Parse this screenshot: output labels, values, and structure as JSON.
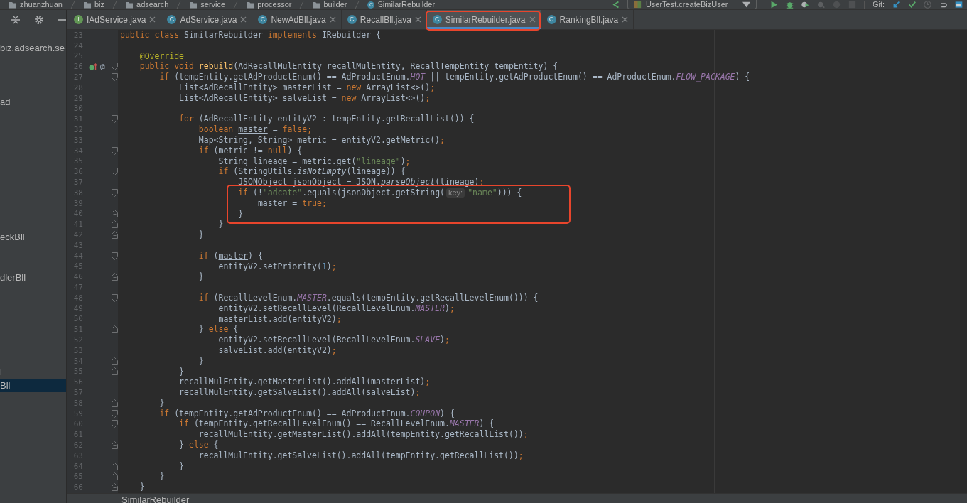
{
  "navigation_bar": {
    "path": [
      {
        "label": "zhuanzhuan",
        "kind": "folder"
      },
      {
        "label": "biz",
        "kind": "folder"
      },
      {
        "label": "adsearch",
        "kind": "folder"
      },
      {
        "label": "service",
        "kind": "folder"
      },
      {
        "label": "processor",
        "kind": "folder"
      },
      {
        "label": "builder",
        "kind": "folder"
      },
      {
        "label": "SimilarRebuilder",
        "kind": "class",
        "icon_letter": "C"
      }
    ],
    "run_configuration": "UserTest.createBizUser",
    "vcs_label": "Git:"
  },
  "project_panel": {
    "items": [
      {
        "label": "biz.adsearch.se",
        "selected": false
      },
      {
        "label": "ad",
        "selected": false
      },
      {
        "label": "eckBll",
        "selected": false
      },
      {
        "label": "dlerBll",
        "selected": false
      },
      {
        "label": "l",
        "selected": false
      },
      {
        "label": "Bll",
        "selected": true
      }
    ]
  },
  "editor_tabs": [
    {
      "label": "IAdService.java",
      "icon_letter": "I",
      "color": "#629755",
      "selected": false,
      "highlighted": false
    },
    {
      "label": "AdService.java",
      "icon_letter": "C",
      "color": "#3e86a0",
      "selected": false,
      "highlighted": false
    },
    {
      "label": "NewAdBll.java",
      "icon_letter": "C",
      "color": "#3e86a0",
      "selected": false,
      "highlighted": false
    },
    {
      "label": "RecallBll.java",
      "icon_letter": "C",
      "color": "#3e86a0",
      "selected": false,
      "highlighted": false
    },
    {
      "label": "SimilarRebuilder.java",
      "icon_letter": "C",
      "color": "#3e86a0",
      "selected": true,
      "highlighted": true
    },
    {
      "label": "RankingBll.java",
      "icon_letter": "C",
      "color": "#3e86a0",
      "selected": false,
      "highlighted": false
    }
  ],
  "editor": {
    "lines": [
      {
        "number": "23",
        "tokens": [
          {
            "text": "public class ",
            "kind": "keyword"
          },
          {
            "text": "SimilarRebuilder "
          },
          {
            "text": "implements ",
            "kind": "keyword"
          },
          {
            "text": "IRebuilder {"
          }
        ]
      },
      {
        "number": "24"
      },
      {
        "number": "25",
        "tokens": [
          {
            "text": "    @Override",
            "kind": "annotation"
          }
        ]
      },
      {
        "number": "26",
        "fold_start": true,
        "override_marker": true,
        "gutter_text": "@",
        "tokens": [
          {
            "text": "    public void ",
            "kind": "keyword"
          },
          {
            "text": "rebuild",
            "kind": "method"
          },
          {
            "text": "(AdRecallMulEntity recallMulEntity, RecallTempEntity tempEntity) {"
          }
        ]
      },
      {
        "number": "27",
        "fold_start": true,
        "tokens": [
          {
            "text": "        if ",
            "kind": "keyword"
          },
          {
            "text": "(tempEntity.getAdProductEnum() == AdProductEnum."
          },
          {
            "text": "HOT",
            "kind": "constant"
          },
          {
            "text": " || tempEntity.getAdProductEnum() == AdProductEnum."
          },
          {
            "text": "FLOW_PACKAGE",
            "kind": "constant"
          },
          {
            "text": ") {"
          }
        ]
      },
      {
        "number": "28",
        "tokens": [
          {
            "text": "            List<AdRecallEntity> masterList = "
          },
          {
            "text": "new ",
            "kind": "keyword"
          },
          {
            "text": "ArrayList<>()"
          },
          {
            "text": ";",
            "kind": "keyword"
          }
        ]
      },
      {
        "number": "29",
        "tokens": [
          {
            "text": "            List<AdRecallEntity> salveList = "
          },
          {
            "text": "new ",
            "kind": "keyword"
          },
          {
            "text": "ArrayList<>()"
          },
          {
            "text": ";",
            "kind": "keyword"
          }
        ]
      },
      {
        "number": "30"
      },
      {
        "number": "31",
        "fold_start": true,
        "tokens": [
          {
            "text": "            for ",
            "kind": "keyword"
          },
          {
            "text": "(AdRecallEntity entityV2 : tempEntity.getRecallList()) {"
          }
        ]
      },
      {
        "number": "32",
        "tokens": [
          {
            "text": "                boolean ",
            "kind": "keyword"
          },
          {
            "text": "master",
            "kind": "underlined"
          },
          {
            "text": " = "
          },
          {
            "text": "false",
            "kind": "keyword"
          },
          {
            "text": ";",
            "kind": "keyword"
          }
        ]
      },
      {
        "number": "33",
        "tokens": [
          {
            "text": "                Map<String, String> metric = entityV2.getMetric()"
          },
          {
            "text": ";",
            "kind": "keyword"
          }
        ]
      },
      {
        "number": "34",
        "fold_start": true,
        "tokens": [
          {
            "text": "                if ",
            "kind": "keyword"
          },
          {
            "text": "(metric != "
          },
          {
            "text": "null",
            "kind": "keyword"
          },
          {
            "text": ") {"
          }
        ]
      },
      {
        "number": "35",
        "tokens": [
          {
            "text": "                    String lineage = metric.get("
          },
          {
            "text": "\"lineage\"",
            "kind": "string"
          },
          {
            "text": ")"
          },
          {
            "text": ";",
            "kind": "keyword"
          }
        ]
      },
      {
        "number": "36",
        "fold_start": true,
        "tokens": [
          {
            "text": "                    if ",
            "kind": "keyword"
          },
          {
            "text": "(StringUtils."
          },
          {
            "text": "isNotEmpty",
            "kind": "static"
          },
          {
            "text": "(lineage)) {"
          }
        ]
      },
      {
        "number": "37",
        "tokens": [
          {
            "text": "                        JSONObject jsonObject = JSON."
          },
          {
            "text": "parseObject",
            "kind": "static"
          },
          {
            "text": "(lineage)"
          },
          {
            "text": ";",
            "kind": "keyword"
          }
        ]
      },
      {
        "number": "38",
        "fold_start": true,
        "boxed": true,
        "tokens": [
          {
            "text": "                        if ",
            "kind": "keyword"
          },
          {
            "text": "(!"
          },
          {
            "text": "\"adcate\"",
            "kind": "string"
          },
          {
            "text": ".equals(jsonObject.getString("
          },
          {
            "text": "key:",
            "kind": "hint"
          },
          {
            "text": "\"name\"",
            "kind": "string"
          },
          {
            "text": "))) {"
          }
        ]
      },
      {
        "number": "39",
        "boxed": true,
        "tokens": [
          {
            "text": "                            master",
            "kind": "underlined"
          },
          {
            "text": " = "
          },
          {
            "text": "true",
            "kind": "keyword"
          },
          {
            "text": ";",
            "kind": "keyword"
          }
        ]
      },
      {
        "number": "40",
        "fold_end": true,
        "boxed": true,
        "tokens": [
          {
            "text": "                        }"
          }
        ]
      },
      {
        "number": "41",
        "fold_end": true,
        "tokens": [
          {
            "text": "                    }"
          }
        ]
      },
      {
        "number": "42",
        "fold_end": true,
        "tokens": [
          {
            "text": "                }"
          }
        ]
      },
      {
        "number": "43"
      },
      {
        "number": "44",
        "fold_start": true,
        "tokens": [
          {
            "text": "                if ",
            "kind": "keyword"
          },
          {
            "text": "("
          },
          {
            "text": "master",
            "kind": "underlined"
          },
          {
            "text": ") {"
          }
        ]
      },
      {
        "number": "45",
        "tokens": [
          {
            "text": "                    entityV2.setPriority("
          },
          {
            "text": "1",
            "kind": "number"
          },
          {
            "text": ")"
          },
          {
            "text": ";",
            "kind": "keyword"
          }
        ]
      },
      {
        "number": "46",
        "fold_end": true,
        "tokens": [
          {
            "text": "                }"
          }
        ]
      },
      {
        "number": "47"
      },
      {
        "number": "48",
        "fold_start": true,
        "tokens": [
          {
            "text": "                if ",
            "kind": "keyword"
          },
          {
            "text": "(RecallLevelEnum."
          },
          {
            "text": "MASTER",
            "kind": "constant"
          },
          {
            "text": ".equals(tempEntity.getRecallLevelEnum())) {"
          }
        ]
      },
      {
        "number": "49",
        "tokens": [
          {
            "text": "                    entityV2.setRecallLevel(RecallLevelEnum."
          },
          {
            "text": "MASTER",
            "kind": "constant"
          },
          {
            "text": ")"
          },
          {
            "text": ";",
            "kind": "keyword"
          }
        ]
      },
      {
        "number": "50",
        "tokens": [
          {
            "text": "                    masterList.add(entityV2)"
          },
          {
            "text": ";",
            "kind": "keyword"
          }
        ]
      },
      {
        "number": "51",
        "fold_end": true,
        "tokens": [
          {
            "text": "                } "
          },
          {
            "text": "else ",
            "kind": "keyword"
          },
          {
            "text": "{"
          }
        ]
      },
      {
        "number": "52",
        "tokens": [
          {
            "text": "                    entityV2.setRecallLevel(RecallLevelEnum."
          },
          {
            "text": "SLAVE",
            "kind": "constant"
          },
          {
            "text": ")"
          },
          {
            "text": ";",
            "kind": "keyword"
          }
        ]
      },
      {
        "number": "53",
        "tokens": [
          {
            "text": "                    salveList.add(entityV2)"
          },
          {
            "text": ";",
            "kind": "keyword"
          }
        ]
      },
      {
        "number": "54",
        "fold_end": true,
        "tokens": [
          {
            "text": "                }"
          }
        ]
      },
      {
        "number": "55",
        "fold_end": true,
        "tokens": [
          {
            "text": "            }"
          }
        ]
      },
      {
        "number": "56",
        "tokens": [
          {
            "text": "            recallMulEntity.getMasterList().addAll(masterList)"
          },
          {
            "text": ";",
            "kind": "keyword"
          }
        ]
      },
      {
        "number": "57",
        "tokens": [
          {
            "text": "            recallMulEntity.getSalveList().addAll(salveList)"
          },
          {
            "text": ";",
            "kind": "keyword"
          }
        ]
      },
      {
        "number": "58",
        "fold_end": true,
        "tokens": [
          {
            "text": "        }"
          }
        ]
      },
      {
        "number": "59",
        "fold_start": true,
        "tokens": [
          {
            "text": "        if ",
            "kind": "keyword"
          },
          {
            "text": "(tempEntity.getAdProductEnum() == AdProductEnum."
          },
          {
            "text": "COUPON",
            "kind": "constant"
          },
          {
            "text": ") {"
          }
        ]
      },
      {
        "number": "60",
        "fold_start": true,
        "tokens": [
          {
            "text": "            if ",
            "kind": "keyword"
          },
          {
            "text": "(tempEntity.getRecallLevelEnum() == RecallLevelEnum."
          },
          {
            "text": "MASTER",
            "kind": "constant"
          },
          {
            "text": ") {"
          }
        ]
      },
      {
        "number": "61",
        "tokens": [
          {
            "text": "                recallMulEntity.getMasterList().addAll(tempEntity.getRecallList())"
          },
          {
            "text": ";",
            "kind": "keyword"
          }
        ]
      },
      {
        "number": "62",
        "fold_end": true,
        "tokens": [
          {
            "text": "            } "
          },
          {
            "text": "else ",
            "kind": "keyword"
          },
          {
            "text": "{"
          }
        ]
      },
      {
        "number": "63",
        "tokens": [
          {
            "text": "                recallMulEntity.getSalveList().addAll(tempEntity.getRecallList())"
          },
          {
            "text": ";",
            "kind": "keyword"
          }
        ]
      },
      {
        "number": "64",
        "fold_end": true,
        "tokens": [
          {
            "text": "            }"
          }
        ]
      },
      {
        "number": "65",
        "fold_end": true,
        "tokens": [
          {
            "text": "        }"
          }
        ]
      },
      {
        "number": "66",
        "fold_end": true,
        "tokens": [
          {
            "text": "    }"
          }
        ]
      }
    ]
  },
  "status_breadcrumb": "SimilarRebuilder"
}
